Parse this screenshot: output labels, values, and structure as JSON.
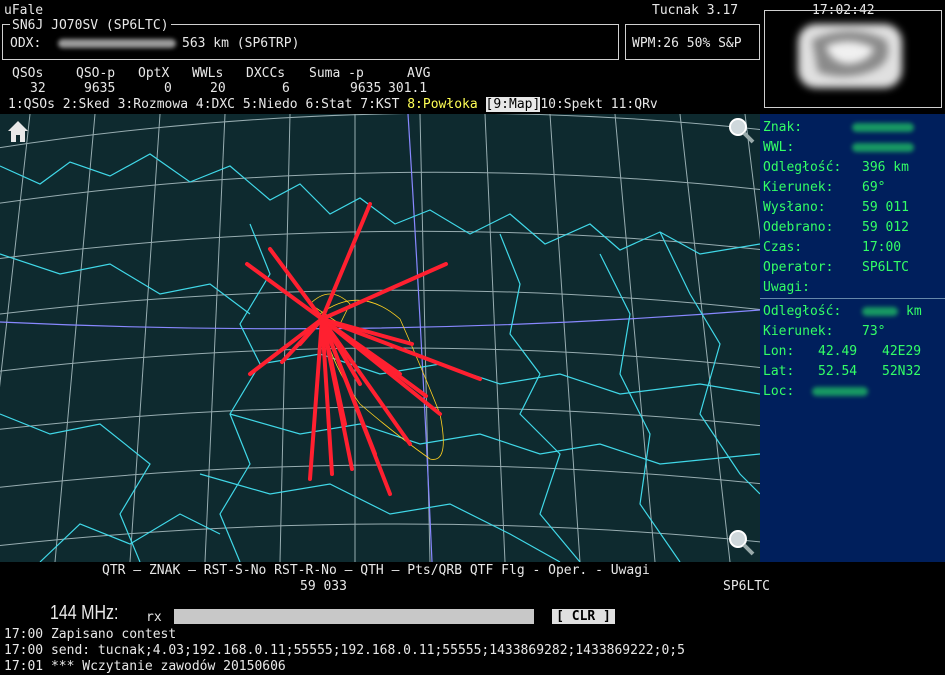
{
  "app": {
    "title": "uFale",
    "name": "Tucnak 3.17",
    "clock": "17:02:42"
  },
  "station": {
    "call_locator": "SN6J JO70SV (SP6LTC)",
    "odx_label": "ODX:",
    "odx_value": "563 km (SP6TRP)"
  },
  "status": {
    "wpm": "WPM:26 50% S&P"
  },
  "stats": {
    "headers": [
      "QSOs",
      "QSO-p",
      "OptX",
      "WWLs",
      "DXCCs",
      "Suma -p",
      "AVG"
    ],
    "values": [
      "32",
      "9635",
      "0",
      "20",
      "6",
      "9635",
      "301.1"
    ]
  },
  "tabs": [
    {
      "label": "1:QSOs"
    },
    {
      "label": "2:Sked"
    },
    {
      "label": "3:Rozmowa"
    },
    {
      "label": "4:DXC"
    },
    {
      "label": "5:Niedo"
    },
    {
      "label": "6:Stat"
    },
    {
      "label": "7:KST"
    },
    {
      "label": "8:Powłoka"
    },
    {
      "label": "9:Map"
    },
    {
      "label": "10:Spekt"
    },
    {
      "label": "11:QRv"
    }
  ],
  "info": {
    "znak_label": "Znak:",
    "wwl_label": "WWL:",
    "odleglosc_label": "Odległość:",
    "odleglosc_value": "396 km",
    "kierunek_label": "Kierunek:",
    "kierunek_value": "69°",
    "wyslano_label": "Wysłano:",
    "wyslano_value": "59 011",
    "odebrano_label": "Odebrano:",
    "odebrano_value": "59 012",
    "czas_label": "Czas:",
    "czas_value": "17:00",
    "operator_label": "Operator:",
    "operator_value": "SP6LTC",
    "uwagi_label": "Uwagi:",
    "odleglosc2_label": "Odległość:",
    "odleglosc2_unit": "km",
    "kierunek2_label": "Kierunek:",
    "kierunek2_value": "73°",
    "lon_label": "Lon:",
    "lon_value": "42.49",
    "lon_code": "42E29",
    "lat_label": "Lat:",
    "lat_value": "52.54",
    "lat_code": "52N32",
    "loc_label": "Loc:"
  },
  "columns": {
    "headers": "QTR — ZNAK — RST-S-No RST-R-No — QTH — Pts/QRB QTF Flg - Oper. - Uwagi",
    "values_rst": "59 033",
    "values_oper": "SP6LTC"
  },
  "band": {
    "label": "144 MHz:",
    "rx_label": "rx",
    "clr_label": "[ CLR ]"
  },
  "log": [
    "17:00 Zapisano contest",
    "17:00 send: tucnak;4.03;192.168.0.11;55555;192.168.0.11;55555;1433869282;1433869222;0;5",
    "17:01 *** Wczytanie zawodów 20150606"
  ],
  "colors": {
    "map_bg": "#0e2a2f",
    "info_bg": "#001f5c",
    "qso_lines": "#ff2030",
    "borders": "#40d8e8",
    "grid": "#b0c4c8",
    "info_text": "#33ff66"
  }
}
